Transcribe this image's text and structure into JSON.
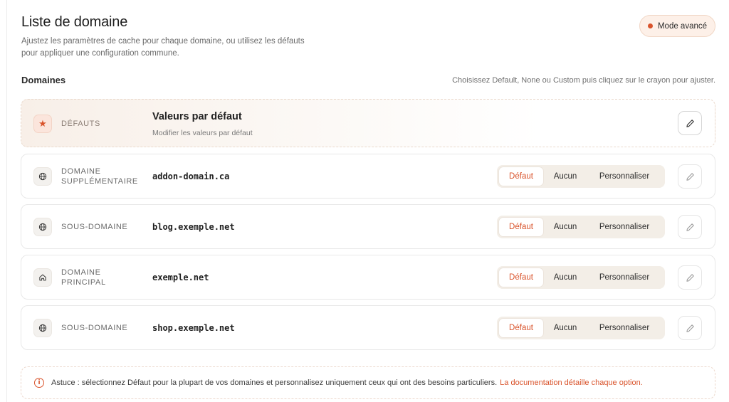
{
  "header": {
    "title": "Liste de domaine",
    "subtitle": "Ajustez les paramètres de cache pour chaque domaine, ou utilisez les défauts pour appliquer une configuration commune.",
    "mode_badge": "Mode avancé"
  },
  "section": {
    "title": "Domaines",
    "hint": "Choisissez Default, None ou Custom puis cliquez sur le crayon pour ajuster."
  },
  "defaults_card": {
    "type_label": "DÉFAUTS",
    "title": "Valeurs par défaut",
    "subtitle": "Modifier les valeurs par défaut",
    "icon": "star-icon"
  },
  "segment_labels": {
    "default": "Défaut",
    "none": "Aucun",
    "custom": "Personnaliser"
  },
  "domains": [
    {
      "type_line1": "DOMAINE",
      "type_line2": "SUPPLÉMENTAIRE",
      "name": "addon-domain.ca",
      "icon": "globe-icon",
      "selected": "default"
    },
    {
      "type_line1": "SOUS-DOMAINE",
      "type_line2": "",
      "name": "blog.exemple.net",
      "icon": "globe-icon",
      "selected": "default"
    },
    {
      "type_line1": "DOMAINE",
      "type_line2": "PRINCIPAL",
      "name": "exemple.net",
      "icon": "home-icon",
      "selected": "default"
    },
    {
      "type_line1": "SOUS-DOMAINE",
      "type_line2": "",
      "name": "shop.exemple.net",
      "icon": "globe-icon",
      "selected": "default"
    }
  ],
  "tip": {
    "text": "Astuce : sélectionnez Défaut pour la plupart de vos domaines et personnalisez uniquement ceux qui ont des besoins particuliers.",
    "link": "La documentation détaille chaque option."
  },
  "colors": {
    "accent": "#d9532b",
    "segment_bg": "#f3eee7",
    "badge_bg": "#fdf0e8"
  }
}
